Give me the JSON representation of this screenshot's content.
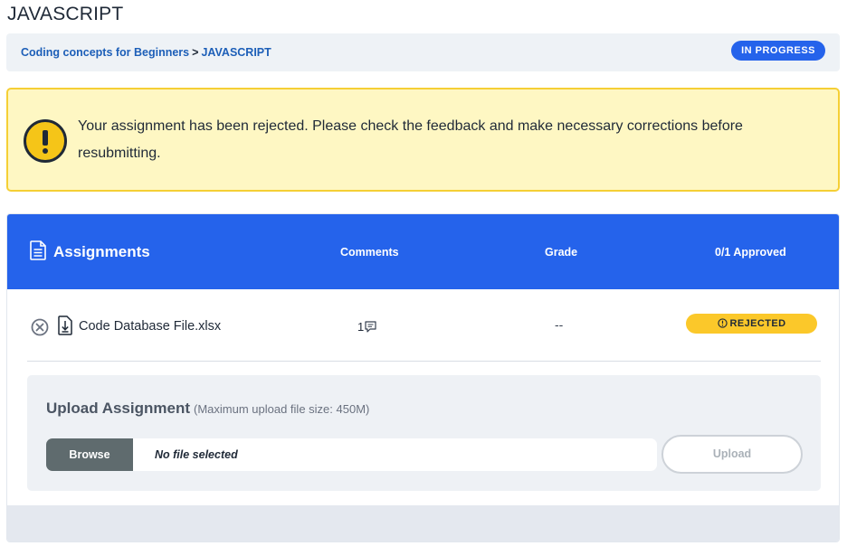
{
  "page": {
    "title": "JAVASCRIPT"
  },
  "breadcrumb": {
    "parent": "Coding concepts for Beginners",
    "separator": ">",
    "current": "JAVASCRIPT",
    "status": "IN PROGRESS"
  },
  "alert": {
    "icon": "exclamation-circle-icon",
    "message": "Your assignment has been rejected. Please check the feedback and make necessary corrections before resubmitting."
  },
  "assignments": {
    "title": "Assignments",
    "title_icon": "document-icon",
    "columns": {
      "comments": "Comments",
      "grade": "Grade",
      "approved": "0/1 Approved"
    },
    "accent_color": "#2563eb",
    "rows": [
      {
        "file_name": "Code Database File.xlsx",
        "comment_count": "1",
        "grade": "--",
        "status": "REJECTED",
        "status_color": "#fbc82a"
      }
    ]
  },
  "upload": {
    "title": "Upload Assignment",
    "subtitle": "(Maximum upload file size: 450M)",
    "browse_label": "Browse",
    "file_status": "No file selected",
    "submit_label": "Upload"
  }
}
